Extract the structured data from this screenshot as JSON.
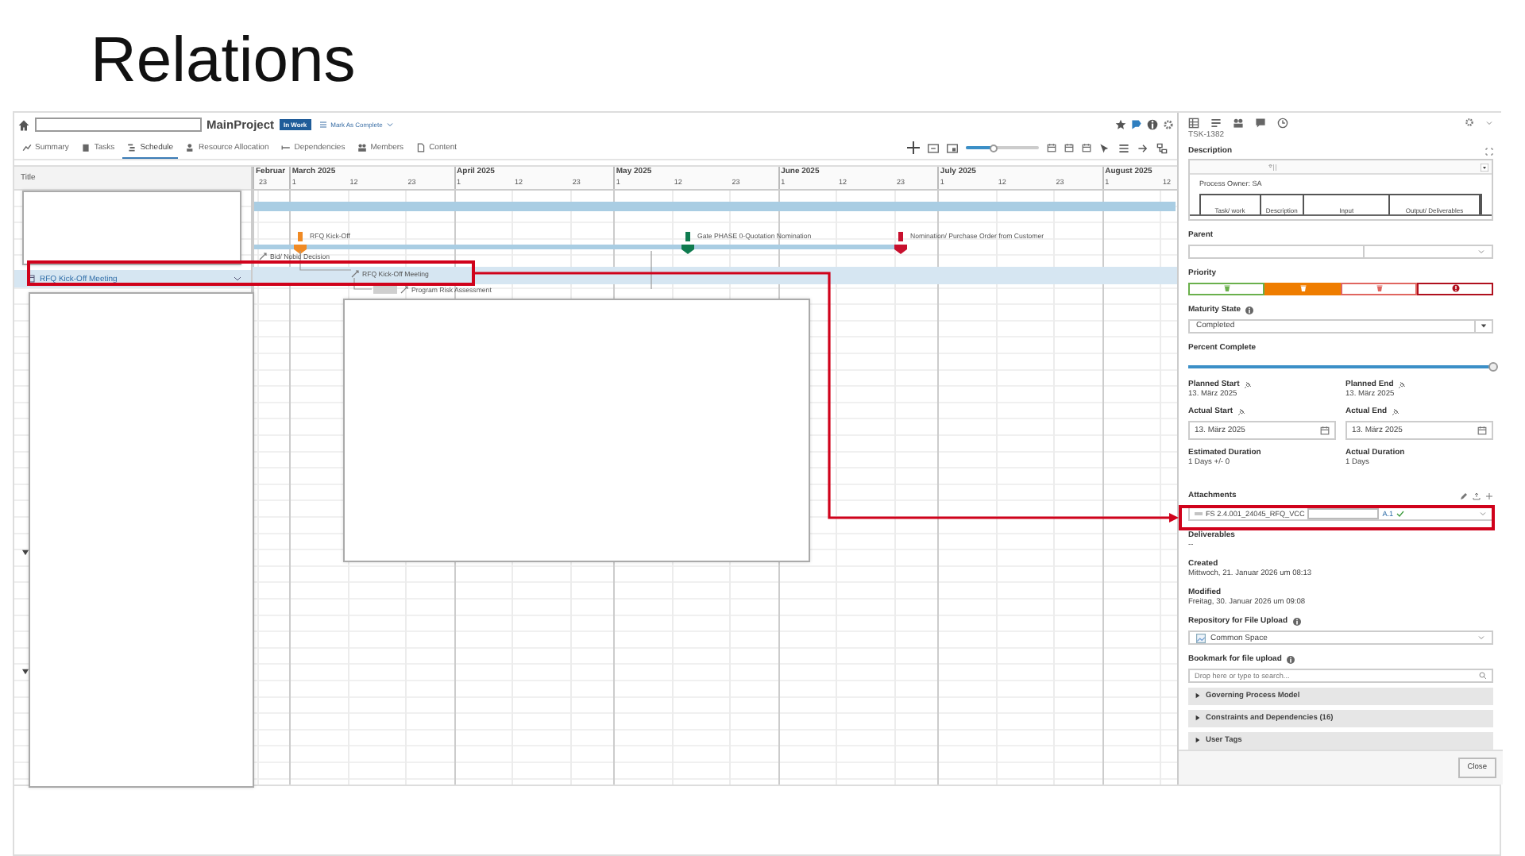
{
  "slide": {
    "title": "Relations"
  },
  "header": {
    "project": "MainProject",
    "status_badge": "In Work",
    "action": "Mark As Complete"
  },
  "tabs": [
    {
      "label": "Summary",
      "selected": false
    },
    {
      "label": "Tasks",
      "selected": false
    },
    {
      "label": "Schedule",
      "selected": true
    },
    {
      "label": "Resource Allocation",
      "selected": false
    },
    {
      "label": "Dependencies",
      "selected": false
    },
    {
      "label": "Members",
      "selected": false
    },
    {
      "label": "Content",
      "selected": false
    }
  ],
  "timeline_zoom": {
    "level": 0.38
  },
  "grid": {
    "title_column": "Title",
    "rows": [
      {
        "title": "RFQ Kick-Off Meeting",
        "selected": true
      }
    ],
    "months": [
      {
        "label": "Februar",
        "ticks": [
          "23"
        ]
      },
      {
        "label": "March 2025",
        "ticks": [
          "1",
          "12",
          "23"
        ]
      },
      {
        "label": "April 2025",
        "ticks": [
          "1",
          "12",
          "23"
        ]
      },
      {
        "label": "May 2025",
        "ticks": [
          "1",
          "12",
          "23"
        ]
      },
      {
        "label": "June 2025",
        "ticks": [
          "1",
          "12",
          "23"
        ]
      },
      {
        "label": "July 2025",
        "ticks": [
          "1",
          "12",
          "23"
        ]
      },
      {
        "label": "August 2025",
        "ticks": [
          "1",
          "12"
        ]
      }
    ],
    "items": [
      {
        "kind": "summary",
        "selected": false
      },
      {
        "kind": "summary",
        "selected": false
      },
      {
        "kind": "milestone",
        "label": "RFQ Kick-Off",
        "color": "#f08a24",
        "selected": false
      },
      {
        "kind": "milestone",
        "label": "Gate PHASE 0-Quotation Nomination",
        "color": "#0f7b4f",
        "selected": false
      },
      {
        "kind": "milestone",
        "label": "Nomination/ Purchase Order from Customer",
        "color": "#c8102e",
        "selected": false
      },
      {
        "kind": "task",
        "label": "Bid/ Nobid Decision",
        "selected": false
      },
      {
        "kind": "task",
        "label": "RFQ Kick-Off Meeting",
        "selected": true
      },
      {
        "kind": "task",
        "label": "Program Risk Assessment",
        "selected": false
      }
    ]
  },
  "details": {
    "id": "TSK-1382",
    "description": {
      "label": "Description",
      "text": "Process Owner: SA",
      "table_headers": [
        "Task/ work",
        "Description",
        "Input",
        "Output/ Deliverables"
      ]
    },
    "parent": {
      "label": "Parent"
    },
    "priority": {
      "label": "Priority",
      "options": [
        {
          "kind": "bin",
          "color": "#6ab04c",
          "selected": false
        },
        {
          "kind": "bin",
          "color": "#ef7d00",
          "selected": true
        },
        {
          "kind": "bin",
          "color": "#e0655f",
          "selected": false
        },
        {
          "kind": "alert",
          "color": "#b0101e",
          "selected": false
        }
      ]
    },
    "maturity": {
      "label": "Maturity State",
      "value": "Completed"
    },
    "percent": {
      "label": "Percent Complete",
      "level": 1
    },
    "dates": [
      {
        "label": "Planned Start",
        "value": "13. März 2025",
        "kind": "text",
        "pinned": true
      },
      {
        "label": "Planned End",
        "value": "13. März 2025",
        "kind": "text",
        "pinned": true
      },
      {
        "label": "Actual Start",
        "value": "13. März 2025",
        "kind": "date_field",
        "pinned": true
      },
      {
        "label": "Actual End",
        "value": "13. März 2025",
        "kind": "date_field",
        "pinned": true
      },
      {
        "label": "Estimated Duration",
        "value": "1 Days +/- 0",
        "kind": "text",
        "pinned": false
      },
      {
        "label": "Actual Duration",
        "value": "1 Days",
        "kind": "text",
        "pinned": false
      }
    ],
    "attachments": {
      "label": "Attachments",
      "items": [
        {
          "name": "FS 2.4.001_24045_RFQ_VCC",
          "version": "A.1",
          "checked": true
        }
      ]
    },
    "deliverables": {
      "label": "Deliverables",
      "value": "--"
    },
    "created": {
      "label": "Created",
      "value": "Mittwoch, 21. Januar 2026 um 08:13"
    },
    "modified": {
      "label": "Modified",
      "value": "Freitag, 30. Januar 2026 um 09:08"
    },
    "repository": {
      "label": "Repository for File Upload",
      "value": "Common Space"
    },
    "bookmark": {
      "label": "Bookmark for file upload",
      "placeholder": "Drop here or type to search..."
    },
    "sections": [
      {
        "label": "Governing Process Model",
        "expanded": false
      },
      {
        "label": "Constraints and Dependencies (16)",
        "expanded": false
      },
      {
        "label": "User Tags",
        "expanded": false
      }
    ],
    "close": "Close"
  }
}
